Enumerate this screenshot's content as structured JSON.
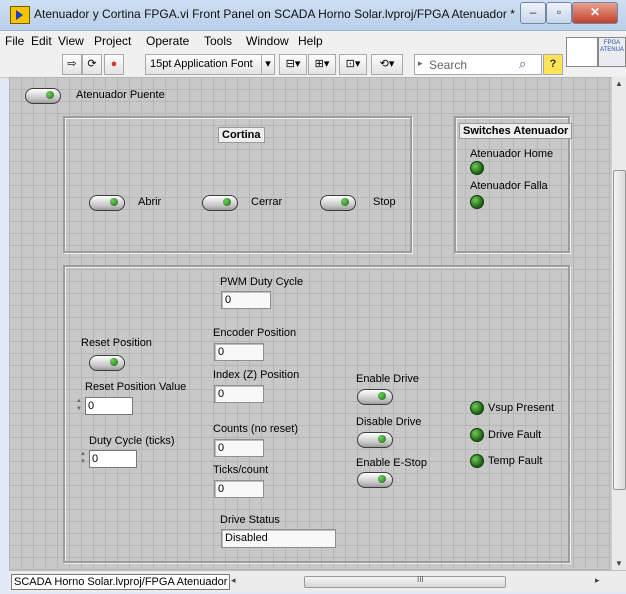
{
  "window": {
    "title": "Atenuador y Cortina FPGA.vi Front Panel on SCADA Horno Solar.lvproj/FPGA Atenuador *"
  },
  "menu": {
    "items": [
      "File",
      "Edit",
      "View",
      "Project",
      "Operate",
      "Tools",
      "Window",
      "Help"
    ]
  },
  "toolbar": {
    "font_selector": "15pt Application Font",
    "search_placeholder": "Search",
    "help_glyph": "?",
    "corner_label": "FPGA ATENUA"
  },
  "controls": {
    "atenuador_puente": "Atenuador Puente",
    "cortina": {
      "title": "Cortina",
      "abrir": "Abrir",
      "cerrar": "Cerrar",
      "stop": "Stop"
    },
    "switches": {
      "title": "Switches Atenuador",
      "home": "Atenuador Home",
      "falla": "Atenuador Falla"
    },
    "pwm": {
      "label": "PWM Duty Cycle",
      "value": "0"
    },
    "reset_position": "Reset Position",
    "reset_position_value": {
      "label": "Reset Position Value",
      "value": "0"
    },
    "duty_cycle_ticks": {
      "label": "Duty Cycle (ticks)",
      "value": "0"
    },
    "encoder_position": {
      "label": "Encoder Position",
      "value": "0"
    },
    "index_position": {
      "label": "Index (Z) Position",
      "value": "0"
    },
    "counts_no_reset": {
      "label": "Counts (no reset)",
      "value": "0"
    },
    "ticks_count": {
      "label": "Ticks/count",
      "value": "0"
    },
    "drive_status": {
      "label": "Drive Status",
      "value": "Disabled"
    },
    "enable_drive": "Enable Drive",
    "disable_drive": "Disable Drive",
    "enable_estop": "Enable E-Stop",
    "vsup_present": "Vsup Present",
    "drive_fault": "Drive Fault",
    "temp_fault": "Temp Fault"
  },
  "status": {
    "path": "SCADA Horno Solar.lvproj/FPGA Atenuador",
    "scroll_glyph": "III"
  },
  "colors": {
    "led_on": "#3d8f2a",
    "panel_bg": "#c8c8c8"
  }
}
